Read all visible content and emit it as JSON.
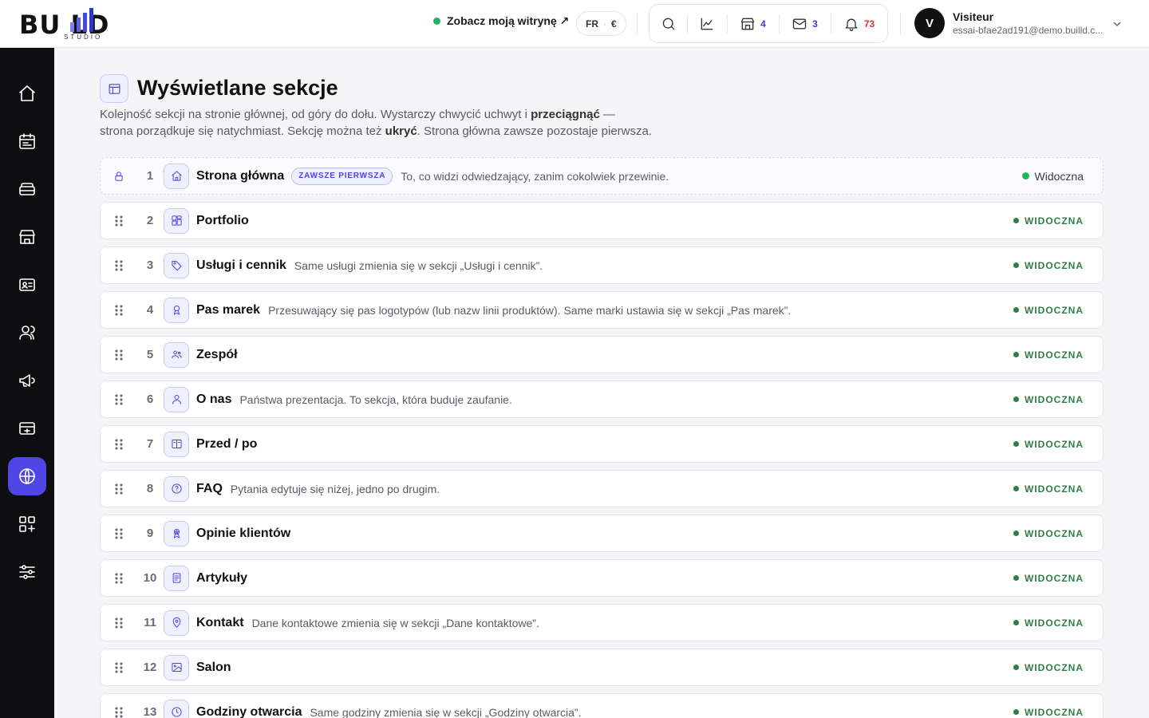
{
  "brand": {
    "logo_text": "BU   LD",
    "logo_sub": "STUDIO"
  },
  "header": {
    "site_link": "Zobacz moją witrynę ↗",
    "lang": "FR",
    "currency": "€",
    "tools": [
      {
        "icon": "search-icon",
        "count": ""
      },
      {
        "icon": "chart-icon",
        "count": ""
      },
      {
        "icon": "store-icon",
        "count": "4"
      },
      {
        "icon": "mail-icon",
        "count": "3"
      },
      {
        "icon": "bell-icon",
        "count": "73"
      }
    ],
    "user": {
      "initial": "V",
      "name": "Visiteur",
      "email": "essai-bfae2ad191@demo.builld.c..."
    }
  },
  "sidebar": {
    "items": [
      {
        "icon": "home-icon",
        "active": false
      },
      {
        "icon": "calendar-icon",
        "active": false
      },
      {
        "icon": "stack-icon",
        "active": false
      },
      {
        "icon": "shop-icon",
        "active": false
      },
      {
        "icon": "contact-card-icon",
        "active": false
      },
      {
        "icon": "users-icon",
        "active": false
      },
      {
        "icon": "megaphone-icon",
        "active": false
      },
      {
        "icon": "card-icon",
        "active": false
      },
      {
        "icon": "globe-icon",
        "active": true
      },
      {
        "icon": "apps-add-icon",
        "active": false
      },
      {
        "icon": "sliders-icon",
        "active": false
      }
    ]
  },
  "page": {
    "title": "Wyświetlane sekcje",
    "desc_1": "Kolejność sekcji na stronie głównej, od góry do dołu. Wystarczy chwycić uchwyt i ",
    "desc_bold_1": "przeciągnąć",
    "desc_2": " —",
    "desc_3": "strona porządkuje się natychmiast. Sekcję można też ",
    "desc_bold_2": "ukryć",
    "desc_4": ". Strona główna zawsze pozostaje pierwsza."
  },
  "sections": [
    {
      "num": "1",
      "icon": "home-icon",
      "name": "Strona główna",
      "pill": "ZAWSZE PIERWSZA",
      "note": "To, co widzi odwiedzający, zanim cokolwiek przewinie.",
      "status": "Widoczna",
      "locked": true
    },
    {
      "num": "2",
      "icon": "grid-icon",
      "name": "Portfolio",
      "pill": "",
      "note": "",
      "status": "WIDOCZNA",
      "locked": false
    },
    {
      "num": "3",
      "icon": "tag-icon",
      "name": "Usługi i cennik",
      "pill": "",
      "note": "Same usługi zmienia się w sekcji „Usługi i cennik”.",
      "status": "WIDOCZNA",
      "locked": false
    },
    {
      "num": "4",
      "icon": "award-icon",
      "name": "Pas marek",
      "pill": "",
      "note": "Przesuwający się pas logotypów (lub nazw linii produktów). Same marki ustawia się w sekcji „Pas marek”.",
      "status": "WIDOCZNA",
      "locked": false
    },
    {
      "num": "5",
      "icon": "team-icon",
      "name": "Zespół",
      "pill": "",
      "note": "",
      "status": "WIDOCZNA",
      "locked": false
    },
    {
      "num": "6",
      "icon": "user-icon",
      "name": "O nas",
      "pill": "",
      "note": "Państwa prezentacja. To sekcja, która buduje zaufanie.",
      "status": "WIDOCZNA",
      "locked": false
    },
    {
      "num": "7",
      "icon": "compare-icon",
      "name": "Przed / po",
      "pill": "",
      "note": "",
      "status": "WIDOCZNA",
      "locked": false
    },
    {
      "num": "8",
      "icon": "question-icon",
      "name": "FAQ",
      "pill": "",
      "note": "Pytania edytuje się niżej, jedno po drugim.",
      "status": "WIDOCZNA",
      "locked": false
    },
    {
      "num": "9",
      "icon": "medal-icon",
      "name": "Opinie klientów",
      "pill": "",
      "note": "",
      "status": "WIDOCZNA",
      "locked": false
    },
    {
      "num": "10",
      "icon": "article-icon",
      "name": "Artykuły",
      "pill": "",
      "note": "",
      "status": "WIDOCZNA",
      "locked": false
    },
    {
      "num": "11",
      "icon": "pin-icon",
      "name": "Kontakt",
      "pill": "",
      "note": "Dane kontaktowe zmienia się w sekcji „Dane kontaktowe”.",
      "status": "WIDOCZNA",
      "locked": false
    },
    {
      "num": "12",
      "icon": "image-icon",
      "name": "Salon",
      "pill": "",
      "note": "",
      "status": "WIDOCZNA",
      "locked": false
    },
    {
      "num": "13",
      "icon": "clock-icon",
      "name": "Godziny otwarcia",
      "pill": "",
      "note": "Same godziny zmienia się w sekcji „Godziny otwarcia”.",
      "status": "WIDOCZNA",
      "locked": false
    }
  ],
  "colors": {
    "accent": "#4f46e5",
    "sidebar": "#0e0e10",
    "status_green": "#2f7d47"
  }
}
